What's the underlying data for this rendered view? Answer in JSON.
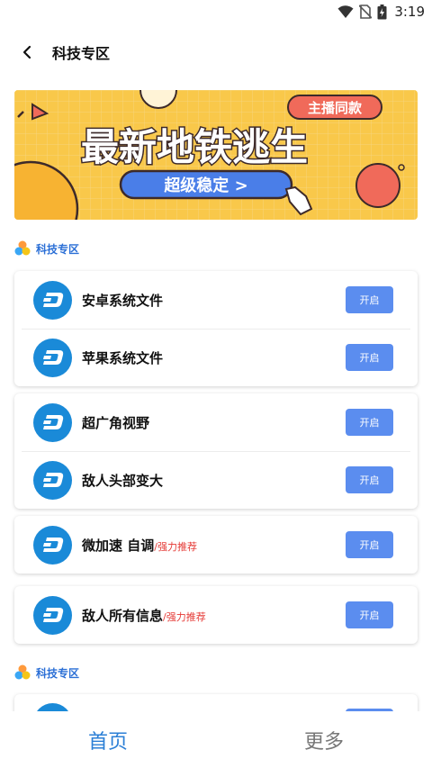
{
  "status_bar": {
    "time": "3:19",
    "icons": [
      "wifi-icon",
      "no-sim-icon",
      "battery-charging-icon"
    ]
  },
  "app_bar": {
    "back_icon": "back-arrow-icon",
    "title": "科技专区"
  },
  "banner": {
    "badge": "主播同款",
    "headline": "最新地铁逃生",
    "cta": "超级稳定 >",
    "colors": {
      "background": "#f9c84a",
      "headline": "#ffffff",
      "outline": "#3d2a2a",
      "cta": "#4a7ee8",
      "badge": "#f06a5a"
    }
  },
  "sections": [
    {
      "title": "科技专区",
      "icon": "colorful-circles-icon"
    },
    {
      "title": "科技专区",
      "icon": "colorful-circles-icon"
    }
  ],
  "cards": [
    {
      "rows": [
        {
          "name": "安卓系统文件",
          "tag": "",
          "button": "开启"
        },
        {
          "name": "苹果系统文件",
          "tag": "",
          "button": "开启"
        }
      ]
    },
    {
      "rows": [
        {
          "name": "超广角视野",
          "tag": "",
          "button": "开启"
        },
        {
          "name": "敌人头部变大",
          "tag": "",
          "button": "开启"
        }
      ]
    },
    {
      "rows": [
        {
          "name": "微加速 自调",
          "tag": "/强力推荐",
          "button": "开启"
        }
      ]
    },
    {
      "rows": [
        {
          "name": "敌人所有信息",
          "tag": "/强力推荐",
          "button": "开启"
        }
      ]
    }
  ],
  "row_icon": "dash-logo-icon",
  "bottom_nav": {
    "items": [
      {
        "label": "首页",
        "active": true
      },
      {
        "label": "更多",
        "active": false
      }
    ]
  },
  "colors": {
    "accent": "#2b7fd6",
    "button": "#5b8def",
    "logo": "#1a8ad8",
    "tag": "#e53935"
  }
}
